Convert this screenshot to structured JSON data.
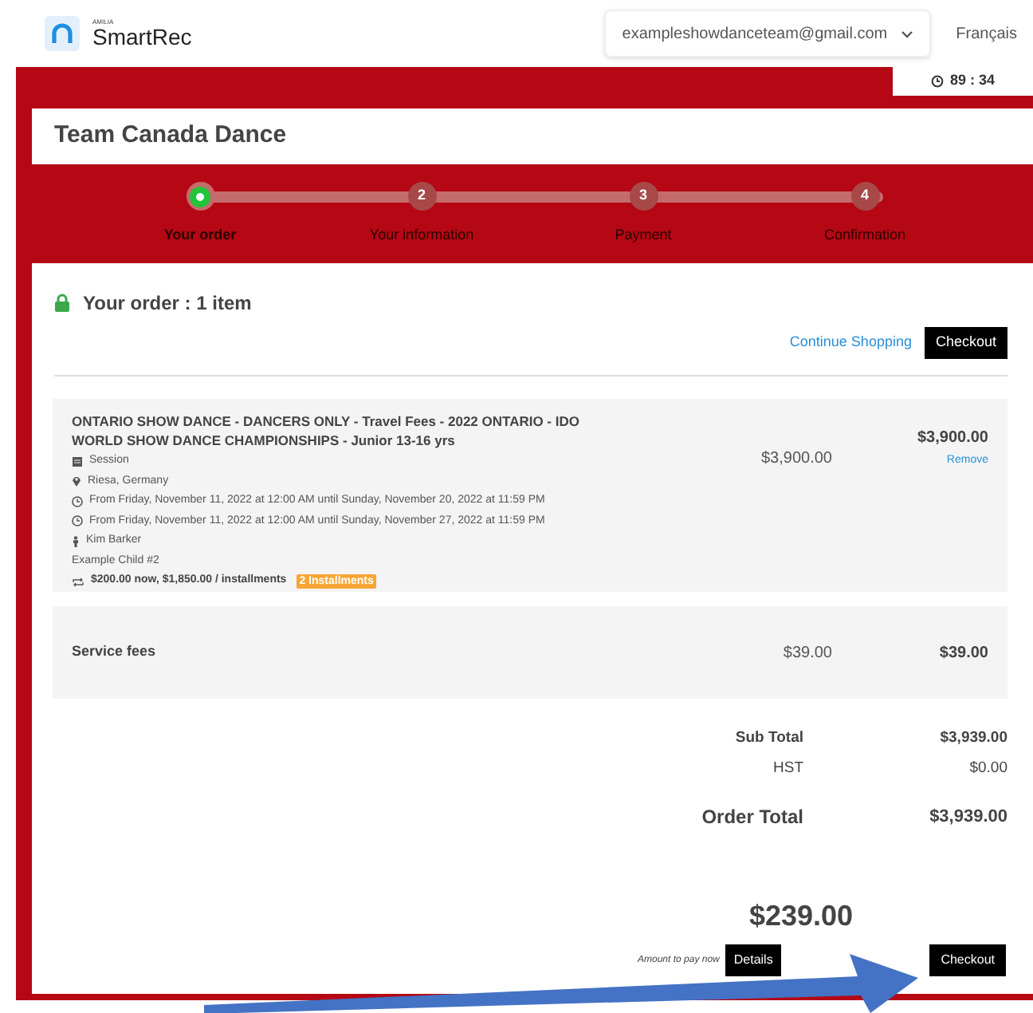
{
  "header": {
    "brand_small": "AMILIA",
    "brand": "SmartRec",
    "account": "exampleshowdanceteam@gmail.com",
    "language": "Français"
  },
  "timer": "89 : 34",
  "title": "Team Canada Dance",
  "steps": [
    {
      "label": "Your order",
      "selected": true
    },
    {
      "number": "2",
      "label": "Your information",
      "selected": false
    },
    {
      "number": "3",
      "label": "Payment",
      "selected": false
    },
    {
      "number": "4",
      "label": "Confirmation",
      "selected": false
    }
  ],
  "order_heading": "Your order : 1 item",
  "continue_link": "Continue Shopping",
  "checkout_top": "Checkout",
  "item": {
    "title": "ONTARIO SHOW DANCE - DANCERS ONLY - Travel Fees - 2022 ONTARIO - IDO WORLD SHOW DANCE CHAMPIONSHIPS - Junior 13-16 yrs",
    "details": [
      {
        "kind": "session",
        "text": "Session"
      },
      {
        "kind": "location",
        "text": "Riesa, Germany"
      },
      {
        "kind": "dates",
        "text": "From Friday, November 11, 2022 at 12:00 AM until Sunday, November 20, 2022 at 11:59 PM"
      },
      {
        "kind": "dates",
        "text": "From Friday, November 11, 2022 at 12:00 AM until Sunday, November 27, 2022 at 11:59 PM"
      },
      {
        "kind": "person",
        "text": "Kim Barker"
      },
      {
        "kind": "plain",
        "text": "Example Child #2"
      }
    ],
    "payment_plan": "$200.00 now, $1,850.00 / installments",
    "installments_badge": "2 Installments",
    "unit_price": "$3,900.00",
    "total": "$3,900.00",
    "remove": "Remove"
  },
  "fees": {
    "label": "Service fees",
    "unit_price": "$39.00",
    "total": "$39.00"
  },
  "totals": [
    {
      "label": "Sub Total",
      "value": "$3,939.00",
      "kind": "bold"
    },
    {
      "label": "HST",
      "value": "$0.00",
      "kind": "plain"
    },
    {
      "label": "Order Total",
      "value": "$3,939.00",
      "kind": "grand"
    }
  ],
  "amount_now": "$239.00",
  "amount_label": "Amount to pay now",
  "details_button": "Details",
  "checkout_bottom": "Checkout"
}
